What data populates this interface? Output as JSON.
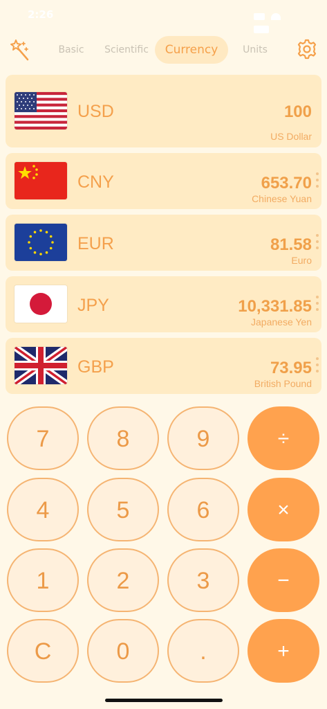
{
  "status_bar": {
    "time": "2:26"
  },
  "tabs": [
    {
      "label": "Basic",
      "active": false
    },
    {
      "label": "Scientific",
      "active": false
    },
    {
      "label": "Currency",
      "active": true
    },
    {
      "label": "Units",
      "active": false
    }
  ],
  "icons": {
    "left": "magic-wand-icon",
    "right": "gear-icon"
  },
  "currencies": [
    {
      "code": "USD",
      "value": "100",
      "name": "US Dollar",
      "flag": "us-flag"
    },
    {
      "code": "CNY",
      "value": "653.70",
      "name": "Chinese Yuan",
      "flag": "cn-flag"
    },
    {
      "code": "EUR",
      "value": "81.58",
      "name": "Euro",
      "flag": "eu-flag"
    },
    {
      "code": "JPY",
      "value": "10,331.85",
      "name": "Japanese Yen",
      "flag": "jp-flag"
    },
    {
      "code": "GBP",
      "value": "73.95",
      "name": "British Pound",
      "flag": "gb-flag"
    }
  ],
  "keypad": {
    "rows": [
      [
        "7",
        "8",
        "9",
        "÷"
      ],
      [
        "4",
        "5",
        "6",
        "×"
      ],
      [
        "1",
        "2",
        "3",
        "−"
      ],
      [
        "C",
        "0",
        ".",
        "+"
      ]
    ]
  },
  "colors": {
    "background": "#fff8e8",
    "accent": "#ffa24e",
    "card": "#ffebc4",
    "text": "#f0a050"
  }
}
